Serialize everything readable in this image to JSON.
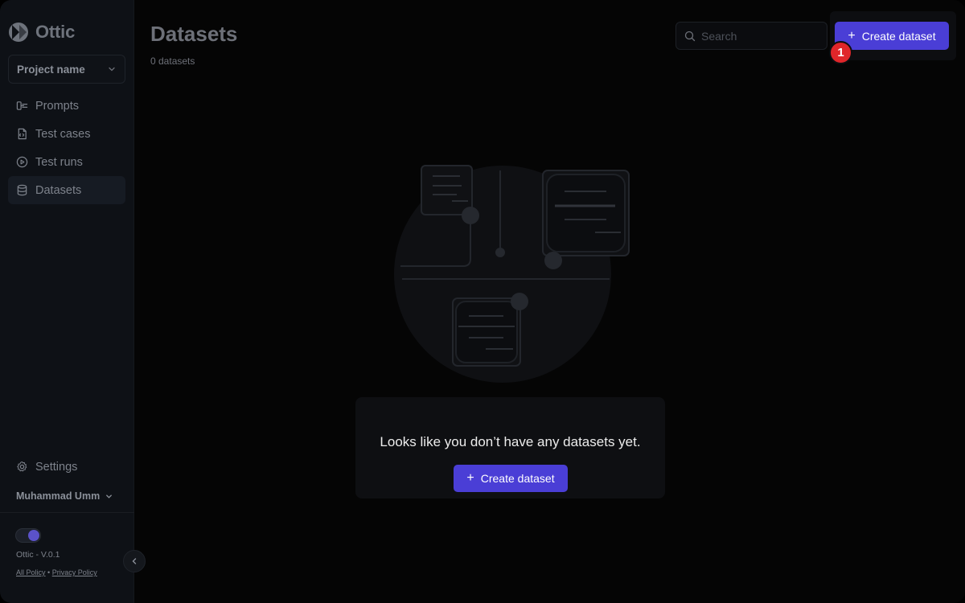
{
  "app": {
    "name": "Ottic"
  },
  "sidebar": {
    "project_label": "Project name",
    "items": [
      {
        "label": "Prompts",
        "icon": "prompts-icon",
        "active": false
      },
      {
        "label": "Test cases",
        "icon": "test-cases-icon",
        "active": false
      },
      {
        "label": "Test runs",
        "icon": "play-circle-icon",
        "active": false
      },
      {
        "label": "Datasets",
        "icon": "database-icon",
        "active": true
      }
    ],
    "settings_label": "Settings",
    "user_name": "Muhammad Umm",
    "version": "Ottic - V.0.1",
    "policy_link": "All Policy",
    "privacy_link": "Privacy Policy",
    "separator": "•"
  },
  "header": {
    "title": "Datasets",
    "subtitle": "0 datasets",
    "search_placeholder": "Search",
    "create_label": "Create dataset",
    "step_badge": "1"
  },
  "empty_state": {
    "message": "Looks like you don’t have any datasets yet.",
    "button_label": "Create dataset"
  },
  "colors": {
    "accent": "#4a3ed6",
    "badge": "#e0262a",
    "sidebar_bg": "#0e1116",
    "main_bg": "#050505"
  }
}
